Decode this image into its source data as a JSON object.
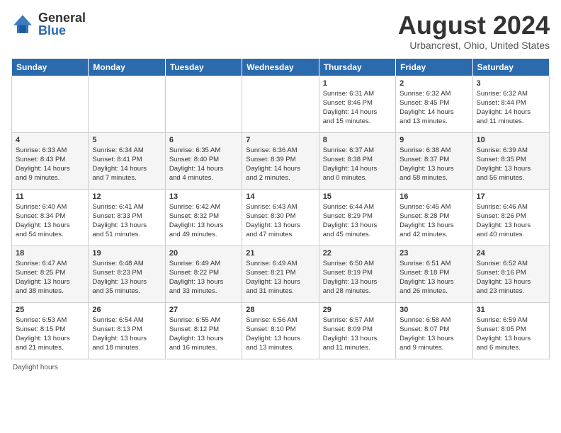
{
  "header": {
    "logo_general": "General",
    "logo_blue": "Blue",
    "month_year": "August 2024",
    "location": "Urbancrest, Ohio, United States"
  },
  "weekdays": [
    "Sunday",
    "Monday",
    "Tuesday",
    "Wednesday",
    "Thursday",
    "Friday",
    "Saturday"
  ],
  "footer": "Daylight hours",
  "weeks": [
    [
      {
        "day": "",
        "info": ""
      },
      {
        "day": "",
        "info": ""
      },
      {
        "day": "",
        "info": ""
      },
      {
        "day": "",
        "info": ""
      },
      {
        "day": "1",
        "info": "Sunrise: 6:31 AM\nSunset: 8:46 PM\nDaylight: 14 hours\nand 15 minutes."
      },
      {
        "day": "2",
        "info": "Sunrise: 6:32 AM\nSunset: 8:45 PM\nDaylight: 14 hours\nand 13 minutes."
      },
      {
        "day": "3",
        "info": "Sunrise: 6:32 AM\nSunset: 8:44 PM\nDaylight: 14 hours\nand 11 minutes."
      }
    ],
    [
      {
        "day": "4",
        "info": "Sunrise: 6:33 AM\nSunset: 8:43 PM\nDaylight: 14 hours\nand 9 minutes."
      },
      {
        "day": "5",
        "info": "Sunrise: 6:34 AM\nSunset: 8:41 PM\nDaylight: 14 hours\nand 7 minutes."
      },
      {
        "day": "6",
        "info": "Sunrise: 6:35 AM\nSunset: 8:40 PM\nDaylight: 14 hours\nand 4 minutes."
      },
      {
        "day": "7",
        "info": "Sunrise: 6:36 AM\nSunset: 8:39 PM\nDaylight: 14 hours\nand 2 minutes."
      },
      {
        "day": "8",
        "info": "Sunrise: 6:37 AM\nSunset: 8:38 PM\nDaylight: 14 hours\nand 0 minutes."
      },
      {
        "day": "9",
        "info": "Sunrise: 6:38 AM\nSunset: 8:37 PM\nDaylight: 13 hours\nand 58 minutes."
      },
      {
        "day": "10",
        "info": "Sunrise: 6:39 AM\nSunset: 8:35 PM\nDaylight: 13 hours\nand 56 minutes."
      }
    ],
    [
      {
        "day": "11",
        "info": "Sunrise: 6:40 AM\nSunset: 8:34 PM\nDaylight: 13 hours\nand 54 minutes."
      },
      {
        "day": "12",
        "info": "Sunrise: 6:41 AM\nSunset: 8:33 PM\nDaylight: 13 hours\nand 51 minutes."
      },
      {
        "day": "13",
        "info": "Sunrise: 6:42 AM\nSunset: 8:32 PM\nDaylight: 13 hours\nand 49 minutes."
      },
      {
        "day": "14",
        "info": "Sunrise: 6:43 AM\nSunset: 8:30 PM\nDaylight: 13 hours\nand 47 minutes."
      },
      {
        "day": "15",
        "info": "Sunrise: 6:44 AM\nSunset: 8:29 PM\nDaylight: 13 hours\nand 45 minutes."
      },
      {
        "day": "16",
        "info": "Sunrise: 6:45 AM\nSunset: 8:28 PM\nDaylight: 13 hours\nand 42 minutes."
      },
      {
        "day": "17",
        "info": "Sunrise: 6:46 AM\nSunset: 8:26 PM\nDaylight: 13 hours\nand 40 minutes."
      }
    ],
    [
      {
        "day": "18",
        "info": "Sunrise: 6:47 AM\nSunset: 8:25 PM\nDaylight: 13 hours\nand 38 minutes."
      },
      {
        "day": "19",
        "info": "Sunrise: 6:48 AM\nSunset: 8:23 PM\nDaylight: 13 hours\nand 35 minutes."
      },
      {
        "day": "20",
        "info": "Sunrise: 6:49 AM\nSunset: 8:22 PM\nDaylight: 13 hours\nand 33 minutes."
      },
      {
        "day": "21",
        "info": "Sunrise: 6:49 AM\nSunset: 8:21 PM\nDaylight: 13 hours\nand 31 minutes."
      },
      {
        "day": "22",
        "info": "Sunrise: 6:50 AM\nSunset: 8:19 PM\nDaylight: 13 hours\nand 28 minutes."
      },
      {
        "day": "23",
        "info": "Sunrise: 6:51 AM\nSunset: 8:18 PM\nDaylight: 13 hours\nand 26 minutes."
      },
      {
        "day": "24",
        "info": "Sunrise: 6:52 AM\nSunset: 8:16 PM\nDaylight: 13 hours\nand 23 minutes."
      }
    ],
    [
      {
        "day": "25",
        "info": "Sunrise: 6:53 AM\nSunset: 8:15 PM\nDaylight: 13 hours\nand 21 minutes."
      },
      {
        "day": "26",
        "info": "Sunrise: 6:54 AM\nSunset: 8:13 PM\nDaylight: 13 hours\nand 18 minutes."
      },
      {
        "day": "27",
        "info": "Sunrise: 6:55 AM\nSunset: 8:12 PM\nDaylight: 13 hours\nand 16 minutes."
      },
      {
        "day": "28",
        "info": "Sunrise: 6:56 AM\nSunset: 8:10 PM\nDaylight: 13 hours\nand 13 minutes."
      },
      {
        "day": "29",
        "info": "Sunrise: 6:57 AM\nSunset: 8:09 PM\nDaylight: 13 hours\nand 11 minutes."
      },
      {
        "day": "30",
        "info": "Sunrise: 6:58 AM\nSunset: 8:07 PM\nDaylight: 13 hours\nand 9 minutes."
      },
      {
        "day": "31",
        "info": "Sunrise: 6:59 AM\nSunset: 8:05 PM\nDaylight: 13 hours\nand 6 minutes."
      }
    ]
  ]
}
